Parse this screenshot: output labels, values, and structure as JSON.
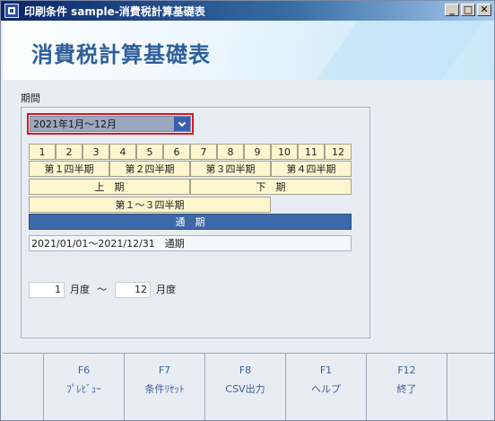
{
  "window": {
    "title": "印刷条件 sample-消費税計算基礎表",
    "min": "_",
    "max": "□",
    "close": "✕"
  },
  "header": {
    "title": "消費税計算基礎表"
  },
  "period": {
    "label": "期間",
    "selected": "2021年1月～12月",
    "months": [
      "1",
      "2",
      "3",
      "4",
      "5",
      "6",
      "7",
      "8",
      "9",
      "10",
      "11",
      "12"
    ],
    "quarters": [
      "第１四半期",
      "第２四半期",
      "第３四半期",
      "第４四半期"
    ],
    "halves": [
      "上　期",
      "下　期"
    ],
    "q1to3": "第１～３四半期",
    "full": "通　期",
    "range": "2021/01/01～2021/12/31　通期",
    "from_month": "1",
    "month_unit": "月度",
    "tilde": "～",
    "to_month": "12",
    "to_unit": "月度"
  },
  "fkeys": [
    {
      "key": "F6",
      "label": "ﾌﾟﾚﾋﾞｭｰ"
    },
    {
      "key": "F7",
      "label": "条件ﾘｾｯﾄ"
    },
    {
      "key": "F8",
      "label": "CSV出力"
    },
    {
      "key": "F1",
      "label": "ヘルプ"
    },
    {
      "key": "F12",
      "label": "終了"
    }
  ]
}
